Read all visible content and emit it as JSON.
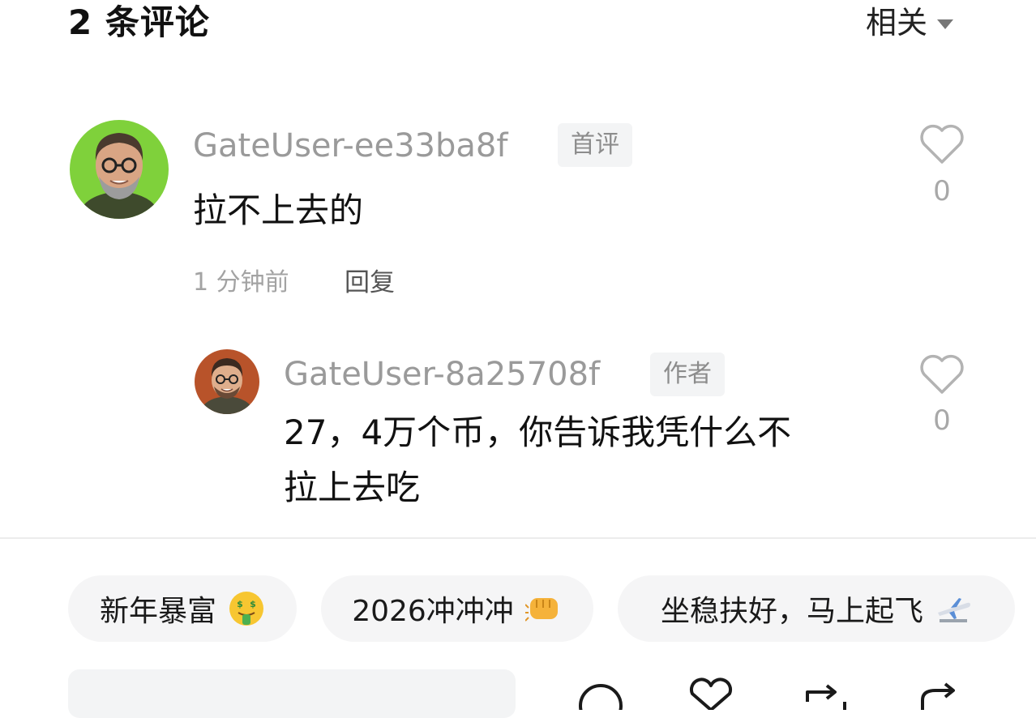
{
  "header": {
    "comment_count_title": "2 条评论",
    "sort_label": "相关"
  },
  "comments": [
    {
      "username": "GateUser-ee33ba8f",
      "tag": "首评",
      "text": "拉不上去的",
      "time": "1 分钟前",
      "reply_label": "回复",
      "likes": "0",
      "replies": [
        {
          "username": "GateUser-8a25708f",
          "tag": "作者",
          "text_line1": "27，4万个币，你告诉我凭什么不",
          "text_line2": "拉上去吃",
          "likes": "0"
        }
      ]
    }
  ],
  "quick_replies": [
    {
      "text": "新年暴富",
      "icon": "money-mouth-face-icon"
    },
    {
      "text": "2026冲冲冲",
      "icon": "fist-icon"
    },
    {
      "text": "坐稳扶好，马上起飞",
      "icon": "airplane-icon"
    }
  ],
  "bottom_bar": {
    "icons": [
      "comment-icon",
      "heart-icon",
      "repost-icon",
      "share-icon"
    ]
  },
  "colors": {
    "avatar1_bg": "#7fd13b",
    "avatar2_bg": "#b8532a"
  }
}
